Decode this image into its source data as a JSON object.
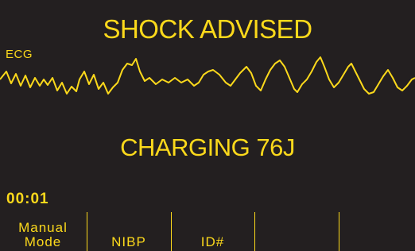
{
  "screen": {
    "advisory": "SHOCK ADVISED",
    "charging_status": "CHARGING 76J",
    "elapsed_time": "00:01"
  },
  "ecg": {
    "label": "ECG",
    "trace_color": "#fcd91b"
  },
  "softkeys": [
    {
      "line1": "Manual",
      "line2": "Mode"
    },
    {
      "line1": "",
      "line2": "NIBP"
    },
    {
      "line1": "",
      "line2": "ID#"
    },
    {
      "line1": "",
      "line2": ""
    },
    {
      "line1": "",
      "line2": ""
    }
  ],
  "colors": {
    "background": "#231f20",
    "foreground": "#fcd91b"
  }
}
